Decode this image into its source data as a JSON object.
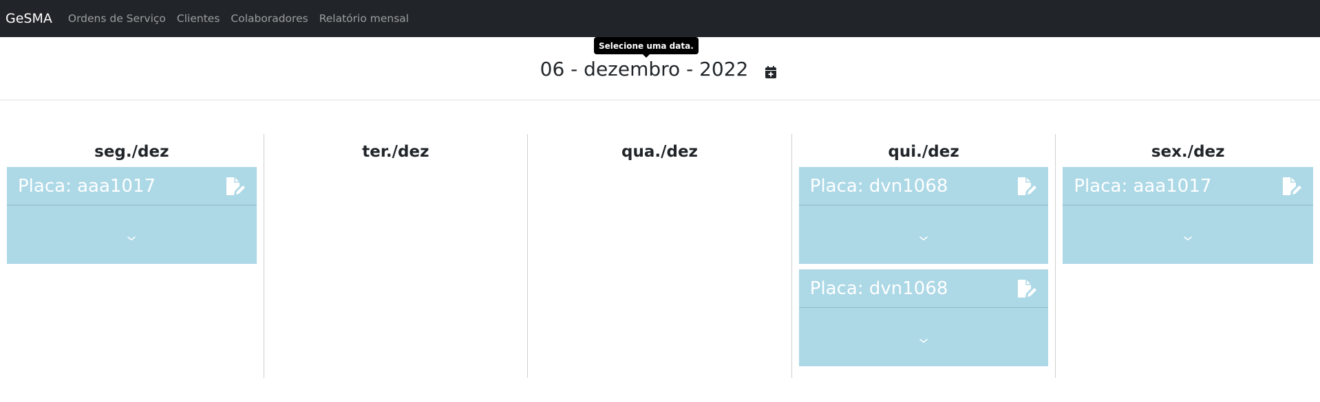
{
  "navbar": {
    "brand": "GeSMA",
    "links": [
      "Ordens de Serviço",
      "Clientes",
      "Colaboradores",
      "Relatório mensal"
    ]
  },
  "header": {
    "tooltip": "Selecione uma data.",
    "date_title": "06 - dezembro - 2022",
    "calendar_icon": "calendar-plus-icon"
  },
  "days": [
    {
      "title": "seg./dez",
      "cards": [
        {
          "label": "Placa: aaa1017"
        }
      ]
    },
    {
      "title": "ter./dez",
      "cards": []
    },
    {
      "title": "qua./dez",
      "cards": []
    },
    {
      "title": "qui./dez",
      "cards": [
        {
          "label": "Placa: dvn1068"
        },
        {
          "label": "Placa: dvn1068"
        }
      ]
    },
    {
      "title": "sex./dez",
      "cards": [
        {
          "label": "Placa: aaa1017"
        }
      ]
    }
  ],
  "icons": {
    "edit": "file-edit-icon",
    "expand": "chevron-down-icon"
  },
  "colors": {
    "navbar": "#212529",
    "card": "#add8e6",
    "text": "#212529"
  }
}
